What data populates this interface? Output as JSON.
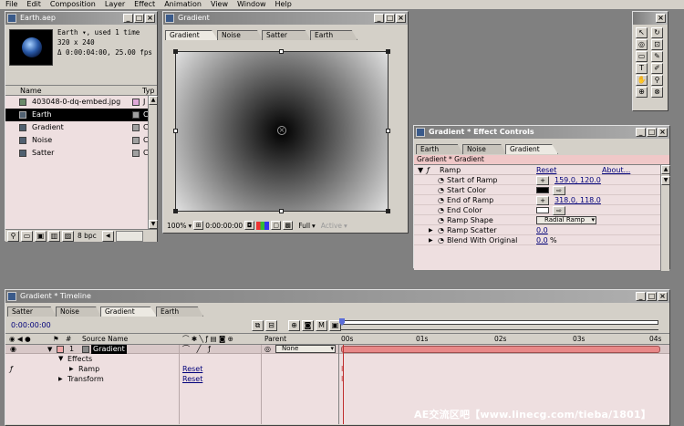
{
  "menu": [
    "File",
    "Edit",
    "Composition",
    "Layer",
    "Effect",
    "Animation",
    "View",
    "Window",
    "Help"
  ],
  "project": {
    "title": "Earth.aep",
    "info_name": "Earth ▾, used 1 time",
    "info_size": "320 x 240",
    "info_duration": "Δ 0:00:04:00, 25.00 fps",
    "col_name": "Name",
    "col_type": "Typ",
    "items": [
      {
        "name": "403048-0-dq-embed.jpg",
        "color": "#e0a8d8",
        "type": "J"
      },
      {
        "name": "Earth",
        "color": "#a0a0a0",
        "type": "C",
        "selected": true
      },
      {
        "name": "Gradient",
        "color": "#a0a0a0",
        "type": "C"
      },
      {
        "name": "Noise",
        "color": "#a0a0a0",
        "type": "C"
      },
      {
        "name": "Satter",
        "color": "#a0a0a0",
        "type": "C"
      }
    ],
    "bpc": "8 bpc"
  },
  "comp": {
    "title": "Gradient",
    "tabs": [
      "Gradient",
      "Noise",
      "Satter",
      "Earth"
    ],
    "zoom": "100%",
    "timecode": "0:00:00:00",
    "resolution": "Full",
    "view": "Active"
  },
  "effects": {
    "title": "Gradient * Effect Controls",
    "tabs": [
      "Earth",
      "Noise",
      "Gradient"
    ],
    "header": "Gradient * Gradient",
    "effect_name": "Ramp",
    "reset": "Reset",
    "about": "About...",
    "props": [
      {
        "label": "Start of Ramp",
        "value": "159.0, 120.0",
        "kind": "point"
      },
      {
        "label": "Start Color",
        "kind": "color",
        "color": "#000000"
      },
      {
        "label": "End of Ramp",
        "value": "318.0, 118.0",
        "kind": "point"
      },
      {
        "label": "End Color",
        "kind": "color",
        "color": "#ffffff"
      },
      {
        "label": "Ramp Shape",
        "value": "Radial Ramp",
        "kind": "dropdown"
      },
      {
        "label": "Ramp Scatter",
        "value": "0.0",
        "kind": "number"
      },
      {
        "label": "Blend With Original",
        "value": "0.0",
        "unit": "%",
        "kind": "number"
      }
    ]
  },
  "timeline": {
    "title": "Gradient * Timeline",
    "tabs": [
      "Satter",
      "Noise",
      "Gradient",
      "Earth"
    ],
    "timecode": "0:00:00:00",
    "col_num": "#",
    "col_source": "Source Name",
    "col_parent": "Parent",
    "layer_num": "1",
    "layer_name": "Gradient",
    "parent": "None",
    "effects": "Effects",
    "ramp": "Ramp",
    "transform": "Transform",
    "reset": "Reset",
    "ruler": [
      "00s",
      "01s",
      "02s",
      "03s",
      "04s"
    ]
  },
  "watermark": "AE交流区吧【www.linecg.com/tieba/1801】"
}
